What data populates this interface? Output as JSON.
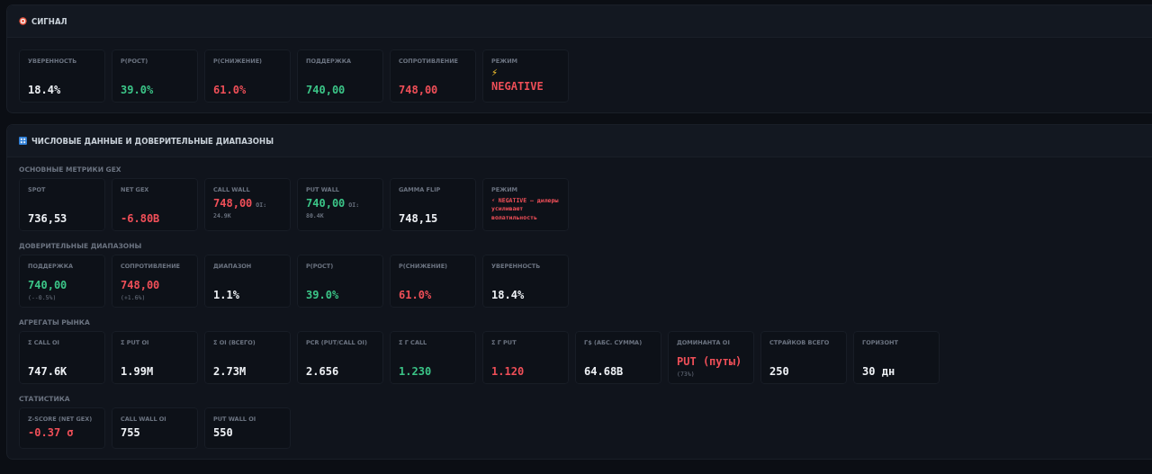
{
  "panels": [
    {
      "title": "СИГНАЛ",
      "groups": [
        {
          "compact": false,
          "cards": [
            {
              "kind": "metric",
              "label": "УВЕРЕННОСТЬ",
              "value": "18.4%",
              "color": "#eef1f5"
            },
            {
              "kind": "metric",
              "label": "P(РОСТ)",
              "value": "39.0%",
              "color": "#3bc487"
            },
            {
              "kind": "metric",
              "label": "P(СНИЖЕНИЕ)",
              "value": "61.0%",
              "color": "#ef4f58"
            },
            {
              "kind": "metric",
              "label": "ПОДДЕРЖКА",
              "value": "740,00",
              "color": "#3bc487"
            },
            {
              "kind": "metric",
              "label": "СОПРОТИВЛЕНИЕ",
              "value": "748,00",
              "color": "#ef4f58"
            },
            {
              "kind": "regime",
              "label": "РЕЖИМ",
              "symbol": "⚡",
              "value": "NEGATIVE",
              "color": "#ef4f58"
            }
          ]
        }
      ]
    },
    {
      "title": "ЧИСЛОВЫЕ ДАННЫЕ И ДОВЕРИТЕЛЬНЫЕ ДИАПАЗОНЫ",
      "groups": [
        {
          "heading": "ОСНОВНЫЕ МЕТРИКИ GEX",
          "compact": false,
          "cards": [
            {
              "kind": "metric",
              "label": "SPOT",
              "value": "736,53",
              "color": "#eef1f5"
            },
            {
              "kind": "metric",
              "label": "NET GEX",
              "value": "-6.80B",
              "color": "#ef4f58"
            },
            {
              "kind": "wall",
              "label": "CALL WALL",
              "value": "748,00",
              "color": "#ef4f58",
              "note_label": "OI:",
              "note": "24.9K"
            },
            {
              "kind": "wall",
              "label": "PUT WALL",
              "value": "740,00",
              "color": "#3bc487",
              "note_label": "OI:",
              "note": "80.4K"
            },
            {
              "kind": "metric",
              "label": "GAMMA FLIP",
              "value": "748,15",
              "color": "#eef1f5"
            },
            {
              "kind": "regime-note",
              "label": "РЕЖИМ",
              "value": "⚡ NEGATIVE — дилеры усиливают волатильность",
              "color": "#ef4f58"
            }
          ]
        },
        {
          "heading": "ДОВЕРИТЕЛЬНЫЕ ДИАПАЗОНЫ",
          "compact": false,
          "cards": [
            {
              "kind": "metric",
              "label": "ПОДДЕРЖКА",
              "value": "740,00",
              "color": "#3bc487",
              "note": "(--0.5%)"
            },
            {
              "kind": "metric",
              "label": "СОПРОТИВЛЕНИЕ",
              "value": "748,00",
              "color": "#ef4f58",
              "note": "(+1.6%)"
            },
            {
              "kind": "metric",
              "label": "ДИАПАЗОН",
              "value": "1.1%",
              "color": "#eef1f5"
            },
            {
              "kind": "metric",
              "label": "P(РОСТ)",
              "value": "39.0%",
              "color": "#3bc487"
            },
            {
              "kind": "metric",
              "label": "P(СНИЖЕНИЕ)",
              "value": "61.0%",
              "color": "#ef4f58"
            },
            {
              "kind": "metric",
              "label": "УВЕРЕННОСТЬ",
              "value": "18.4%",
              "color": "#eef1f5"
            }
          ]
        },
        {
          "heading": "АГРЕГАТЫ РЫНКА",
          "compact": false,
          "cards": [
            {
              "kind": "metric",
              "label": "Σ CALL OI",
              "value": "747.6K",
              "color": "#eef1f5"
            },
            {
              "kind": "metric",
              "label": "Σ PUT OI",
              "value": "1.99M",
              "color": "#eef1f5"
            },
            {
              "kind": "metric",
              "label": "Σ OI (ВСЕГО)",
              "value": "2.73M",
              "color": "#eef1f5"
            },
            {
              "kind": "metric",
              "label": "PCR (PUT/CALL OI)",
              "value": "2.656",
              "color": "#eef1f5"
            },
            {
              "kind": "metric",
              "label": "Σ Γ CALL",
              "value": "1.230",
              "color": "#3bc487"
            },
            {
              "kind": "metric",
              "label": "Σ Γ PUT",
              "value": "1.120",
              "color": "#ef4f58"
            },
            {
              "kind": "metric",
              "label": "Γ$ (АБС. СУММА)",
              "value": "64.68B",
              "color": "#eef1f5"
            },
            {
              "kind": "metric",
              "label": "ДОМИНАНТА OI",
              "value": "PUT (путы)",
              "color": "#ef4f58",
              "note": "(73%)"
            },
            {
              "kind": "metric",
              "label": "СТРАЙКОВ ВСЕГО",
              "value": "250",
              "color": "#eef1f5"
            },
            {
              "kind": "metric",
              "label": "ГОРИЗОНТ",
              "value": "30 дн",
              "color": "#eef1f5"
            }
          ]
        },
        {
          "heading": "СТАТИСТИКА",
          "compact": true,
          "cards": [
            {
              "kind": "metric",
              "label": "Z-SCORE (NET GEX)",
              "value": "-0.37 σ",
              "color": "#ef4f58"
            },
            {
              "kind": "metric",
              "label": "CALL WALL OI",
              "value": "755",
              "color": "#eef1f5"
            },
            {
              "kind": "metric",
              "label": "PUT WALL OI",
              "value": "550",
              "color": "#eef1f5"
            }
          ]
        }
      ]
    }
  ]
}
